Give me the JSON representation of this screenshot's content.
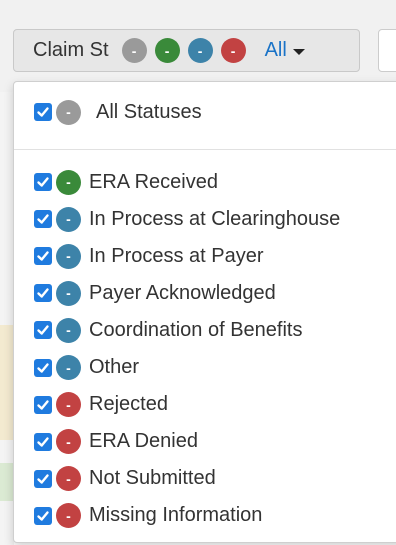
{
  "filter": {
    "label": "Claim St",
    "selected": "All",
    "chips": [
      {
        "symbol": "-",
        "color": "#9a9a9a"
      },
      {
        "symbol": "-",
        "color": "#3a8a3a"
      },
      {
        "symbol": "-",
        "color": "#3d83a9"
      },
      {
        "symbol": "-",
        "color": "#c24242"
      }
    ]
  },
  "menu": {
    "all_item": {
      "label": "All Statuses",
      "checked": true,
      "symbol": "-",
      "color": "#9a9a9a"
    },
    "items": [
      {
        "label": "ERA Received",
        "checked": true,
        "symbol": "-",
        "color": "#3a8a3a"
      },
      {
        "label": "In Process at Clearinghouse",
        "checked": true,
        "symbol": "-",
        "color": "#3d83a9"
      },
      {
        "label": "In Process at Payer",
        "checked": true,
        "symbol": "-",
        "color": "#3d83a9"
      },
      {
        "label": "Payer Acknowledged",
        "checked": true,
        "symbol": "-",
        "color": "#3d83a9"
      },
      {
        "label": "Coordination of Benefits",
        "checked": true,
        "symbol": "-",
        "color": "#3d83a9"
      },
      {
        "label": "Other",
        "checked": true,
        "symbol": "-",
        "color": "#3d83a9"
      },
      {
        "label": "Rejected",
        "checked": true,
        "symbol": "-",
        "color": "#c24242"
      },
      {
        "label": "ERA Denied",
        "checked": true,
        "symbol": "-",
        "color": "#c24242"
      },
      {
        "label": "Not Submitted",
        "checked": true,
        "symbol": "-",
        "color": "#c24242"
      },
      {
        "label": "Missing Information",
        "checked": true,
        "symbol": "-",
        "color": "#c24242"
      }
    ]
  },
  "colors": {
    "checkbox": "#1f7bdf",
    "link": "#1a73c7"
  }
}
